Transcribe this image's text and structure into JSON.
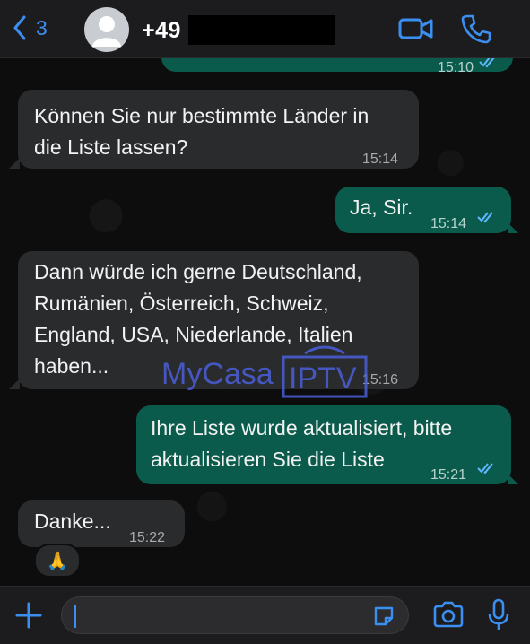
{
  "header": {
    "back_count": "3",
    "contact_name": "+49"
  },
  "messages": [
    {
      "id": "m0",
      "direction": "out",
      "text": "",
      "time": "15:10"
    },
    {
      "id": "m1",
      "direction": "in",
      "line1": "Können Sie nur bestimmte Länder in",
      "line2": "die Liste lassen?",
      "time": "15:14"
    },
    {
      "id": "m2",
      "direction": "out",
      "text": "Ja, Sir.",
      "time": "15:14"
    },
    {
      "id": "m3",
      "direction": "in",
      "line1": "Dann würde ich gerne Deutschland,",
      "line2": "Rumänien, Österreich, Schweiz,",
      "line3": "England, USA, Niederlande, Italien",
      "line4": "haben...",
      "time": "15:16"
    },
    {
      "id": "m4",
      "direction": "out",
      "line1": "Ihre Liste wurde aktualisiert, bitte",
      "line2": "aktualisieren Sie die Liste",
      "time": "15:21"
    },
    {
      "id": "m5",
      "direction": "in",
      "text": "Danke...",
      "time": "15:22",
      "reaction": "🙏"
    }
  ],
  "watermark": {
    "brand_left": "MyCasa",
    "brand_right": "IPTV"
  },
  "colors": {
    "accent": "#3b8ff0",
    "outgoing_bubble": "#0b5b4c",
    "incoming_bubble": "#2a2b2d",
    "read_ticks": "#5fb8ff"
  },
  "icons": [
    "chevron-left-icon",
    "avatar-icon",
    "video-call-icon",
    "phone-icon",
    "plus-icon",
    "sticker-icon",
    "camera-icon",
    "microphone-icon",
    "double-check-icon"
  ]
}
